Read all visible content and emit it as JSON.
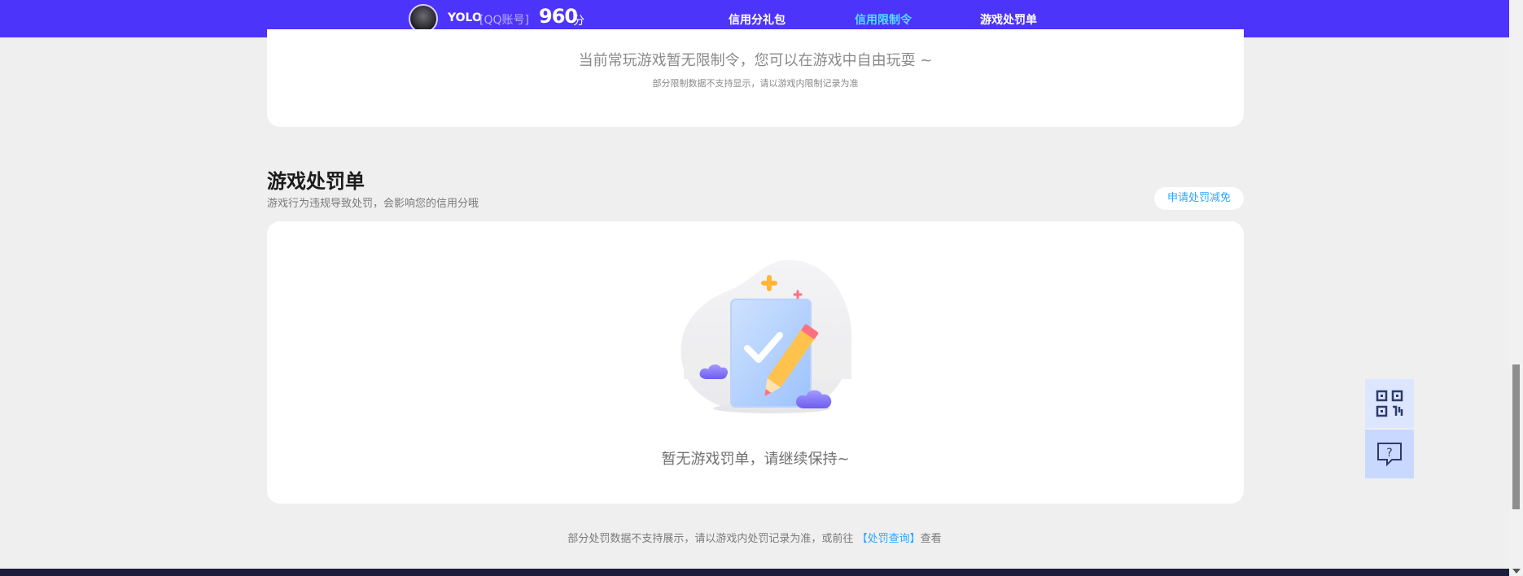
{
  "header": {
    "username": "YOLO",
    "account_type": "[QQ账号]",
    "score": "960",
    "score_unit": "分",
    "nav": [
      {
        "label": "信用分礼包",
        "active": false
      },
      {
        "label": "信用限制令",
        "active": true
      },
      {
        "label": "游戏处罚单",
        "active": false
      }
    ],
    "accent_color": "#4d34fb",
    "active_color": "#4ee0ff"
  },
  "limit_section": {
    "message": "当前常玩游戏暂无限制令，您可以在游戏中自由玩耍 ~",
    "note": "部分限制数据不支持显示，请以游戏内限制记录为准"
  },
  "penalty_section": {
    "title": "游戏处罚单",
    "subtitle": "游戏行为违规导致处罚，会影响您的信用分哦",
    "apply_button": "申请处罚减免",
    "empty_message": "暂无游戏罚单，请继续保持~"
  },
  "footer": {
    "note_prefix": "部分处罚数据不支持展示，请以游戏内处罚记录为准，或前往",
    "link_text": "【处罚查询】",
    "note_suffix": "查看"
  },
  "side_tools": [
    {
      "icon": "qr-code-icon"
    },
    {
      "icon": "help-chat-icon"
    }
  ]
}
